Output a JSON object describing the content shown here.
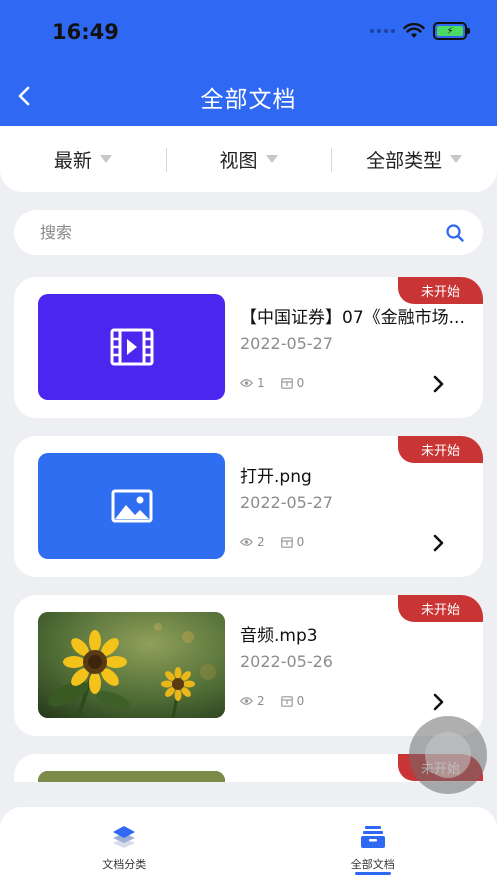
{
  "status_bar": {
    "time": "16:49"
  },
  "header": {
    "title": "全部文档"
  },
  "filters": [
    {
      "label": "最新"
    },
    {
      "label": "视图"
    },
    {
      "label": "全部类型"
    }
  ],
  "search": {
    "placeholder": "搜索"
  },
  "documents": [
    {
      "title": "【中国证券】07《金融市场...",
      "date": "2022-05-27",
      "views": "1",
      "downloads": "0",
      "status": "未开始",
      "thumb_type": "video",
      "thumb_color": "#4a26ee"
    },
    {
      "title": "打开.png",
      "date": "2022-05-27",
      "views": "2",
      "downloads": "0",
      "status": "未开始",
      "thumb_type": "image",
      "thumb_color": "#2f6ef0"
    },
    {
      "title": "音频.mp3",
      "date": "2022-05-26",
      "views": "2",
      "downloads": "0",
      "status": "未开始",
      "thumb_type": "photo-sunflower",
      "thumb_color": "#4f6a2c"
    },
    {
      "title": "",
      "date": "",
      "views": "",
      "downloads": "",
      "status": "未开始",
      "thumb_type": "photo-sunflower",
      "thumb_color": "#3d5a24"
    }
  ],
  "tabbar": [
    {
      "label": "文档分类",
      "icon": "layers-icon",
      "active": false
    },
    {
      "label": "全部文档",
      "icon": "inbox-icon",
      "active": true
    }
  ],
  "colors": {
    "primary": "#2f68f2",
    "badge": "#c93435",
    "background": "#eeeff3"
  }
}
